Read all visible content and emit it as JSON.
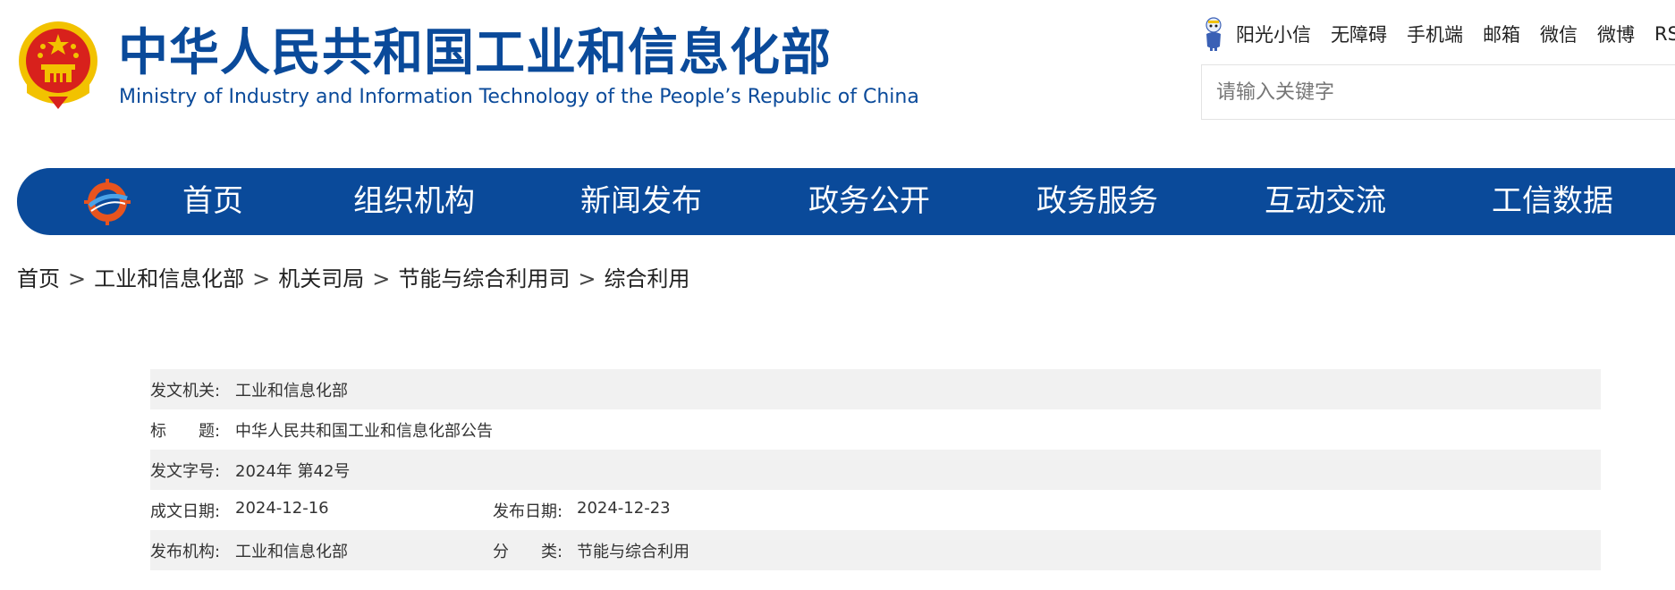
{
  "header": {
    "title_cn": "中华人民共和国工业和信息化部",
    "title_en": "Ministry of Industry and Information Technology of the People’s Republic of China"
  },
  "toplinks": [
    "阳光小信",
    "无障碍",
    "手机端",
    "邮箱",
    "微信",
    "微博",
    "RS"
  ],
  "search": {
    "placeholder": "请输入关键字"
  },
  "nav": {
    "items": [
      "首页",
      "组织机构",
      "新闻发布",
      "政务公开",
      "政务服务",
      "互动交流",
      "工信数据"
    ]
  },
  "breadcrumb": [
    "首页",
    "工业和信息化部",
    "机关司局",
    "节能与综合利用司",
    "综合利用"
  ],
  "breadcrumb_sep": ">",
  "info": {
    "issuer_label": "发文机关:",
    "issuer": "工业和信息化部",
    "title_label": "标　　题:",
    "title": "中华人民共和国工业和信息化部公告",
    "docno_label": "发文字号:",
    "docno": "2024年 第42号",
    "written_label": "成文日期:",
    "written": "2024-12-16",
    "published_label": "发布日期:",
    "published": "2024-12-23",
    "org_label": "发布机构:",
    "org": "工业和信息化部",
    "category_label": "分　　类:",
    "category": "节能与综合利用"
  },
  "colors": {
    "brand_blue": "#0a4a9a",
    "row_shade": "#f1f1f1",
    "emblem_red": "#d8211c",
    "emblem_gold": "#f2c200"
  },
  "icons": {
    "emblem": "national-emblem-icon",
    "mascot": "mascot-icon",
    "nav_logo": "ministry-logo-icon"
  }
}
